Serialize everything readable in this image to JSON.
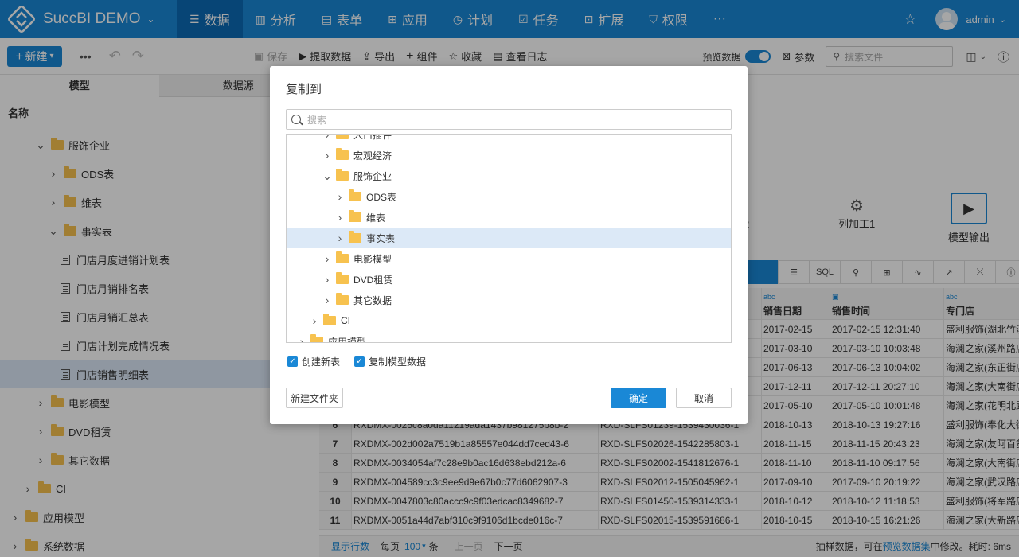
{
  "topnav": {
    "brand": "SuccBI DEMO",
    "tabs": [
      {
        "label": "数据",
        "icon": "database-icon",
        "glyph": "☰"
      },
      {
        "label": "分析",
        "icon": "bar-chart-icon",
        "glyph": "▥"
      },
      {
        "label": "表单",
        "icon": "form-icon",
        "glyph": "▤"
      },
      {
        "label": "应用",
        "icon": "apps-icon",
        "glyph": "⊞"
      },
      {
        "label": "计划",
        "icon": "clock-icon",
        "glyph": "◷"
      },
      {
        "label": "任务",
        "icon": "task-icon",
        "glyph": "☑"
      },
      {
        "label": "扩展",
        "icon": "extension-icon",
        "glyph": "⊡"
      },
      {
        "label": "权限",
        "icon": "shield-icon",
        "glyph": "⛉"
      },
      {
        "label": "···",
        "icon": "more-icon",
        "glyph": ""
      }
    ],
    "user": "admin"
  },
  "toolbar": {
    "new_label": "新建",
    "save": "保存",
    "extract": "提取数据",
    "export": "导出",
    "component": "组件",
    "favorite": "收藏",
    "log": "查看日志",
    "preview": "预览数据",
    "params": "参数",
    "search_placeholder": "搜索文件"
  },
  "left": {
    "tab_model": "模型",
    "tab_source": "数据源",
    "name_header": "名称",
    "tree": [
      {
        "label": "服饰企业",
        "type": "folder",
        "level": 2,
        "open": true
      },
      {
        "label": "ODS表",
        "type": "folder",
        "level": 3,
        "open": false
      },
      {
        "label": "维表",
        "type": "folder",
        "level": 3,
        "open": false
      },
      {
        "label": "事实表",
        "type": "folder",
        "level": 3,
        "open": true
      },
      {
        "label": "门店月度进销计划表",
        "type": "table",
        "level": 4
      },
      {
        "label": "门店月销排名表",
        "type": "table",
        "level": 4
      },
      {
        "label": "门店月销汇总表",
        "type": "table",
        "level": 4
      },
      {
        "label": "门店计划完成情况表",
        "type": "table",
        "level": 4
      },
      {
        "label": "门店销售明细表",
        "type": "table",
        "level": 4,
        "selected": true
      },
      {
        "label": "电影模型",
        "type": "folder",
        "level": 2,
        "open": false
      },
      {
        "label": "DVD租赁",
        "type": "folder",
        "level": 2,
        "open": false
      },
      {
        "label": "其它数据",
        "type": "folder",
        "level": 2,
        "open": false
      },
      {
        "label": "CI",
        "type": "folder",
        "level": 1,
        "open": false
      },
      {
        "label": "应用模型",
        "type": "folder",
        "level": 0,
        "open": false
      },
      {
        "label": "系统数据",
        "type": "folder",
        "level": 0,
        "open": false
      }
    ]
  },
  "flow": {
    "node1": "工2",
    "node2": "列加工1",
    "node3": "模型输出"
  },
  "data_toolbar": [
    "",
    "☰",
    "SQL",
    "⚲",
    "⊞",
    "∿",
    "↗",
    "⤫",
    "ⓘ"
  ],
  "grid": {
    "headers": [
      {
        "type": "",
        "name": ""
      },
      {
        "type": "",
        "name": ""
      },
      {
        "type": "",
        "name": ""
      },
      {
        "type": "abc",
        "name": "销售日期"
      },
      {
        "type": "▣",
        "name": "销售时间"
      },
      {
        "type": "abc",
        "name": "专门店"
      }
    ],
    "rows": [
      [
        "",
        "",
        "",
        "2017-02-15",
        "2017-02-15 12:31:40",
        "盛利服饰(湖北竹溪"
      ],
      [
        "",
        "",
        "",
        "2017-03-10",
        "2017-03-10 10:03:48",
        "海澜之家(溪州路店"
      ],
      [
        "",
        "",
        "",
        "2017-06-13",
        "2017-06-13 10:04:02",
        "海澜之家(东正街店"
      ],
      [
        "",
        "",
        "",
        "2017-12-11",
        "2017-12-11 20:27:10",
        "海澜之家(大南街店"
      ],
      [
        "",
        "",
        "",
        "2017-05-10",
        "2017-05-10 10:01:48",
        "海澜之家(花明北路"
      ],
      [
        "6",
        "RXDMX-0025c8a0da11219ada1437b981275b8b-2",
        "RXD-SLFS01239-1539430036-1",
        "2018-10-13",
        "2018-10-13 19:27:16",
        "盛利服饰(奉化大街"
      ],
      [
        "7",
        "RXDMX-002d002a7519b1a85557e044dd7ced43-6",
        "RXD-SLFS02026-1542285803-1",
        "2018-11-15",
        "2018-11-15 20:43:23",
        "海澜之家(友阿百货"
      ],
      [
        "8",
        "RXDMX-0034054af7c28e9b0ac16d638ebd212a-6",
        "RXD-SLFS02002-1541812676-1",
        "2018-11-10",
        "2018-11-10 09:17:56",
        "海澜之家(大南街店"
      ],
      [
        "9",
        "RXDMX-004589cc3c9ee9d9e67b0c77d6062907-3",
        "RXD-SLFS02012-1505045962-1",
        "2017-09-10",
        "2017-09-10 20:19:22",
        "海澜之家(武汉路店"
      ],
      [
        "10",
        "RXDMX-0047803c80accc9c9f03edcac8349682-7",
        "RXD-SLFS01450-1539314333-1",
        "2018-10-12",
        "2018-10-12 11:18:53",
        "盛利服饰(将军路店"
      ],
      [
        "11",
        "RXDMX-0051a44d7abf310c9f9106d1bcde016c-7",
        "RXD-SLFS02015-1539591686-1",
        "2018-10-15",
        "2018-10-15 16:21:26",
        "海澜之家(大新路店"
      ]
    ]
  },
  "pager": {
    "show_rows": "显示行数",
    "per_page": "每页",
    "per_page_value": "100",
    "unit": "条",
    "prev": "上一页",
    "next": "下一页",
    "note_prefix": "抽样数据，可在",
    "note_link": "预览数据集",
    "note_suffix": "中修改。耗时: 6ms"
  },
  "dialog": {
    "title": "复制到",
    "search_placeholder": "搜索",
    "tree": [
      {
        "label": "人口插件",
        "level": 2,
        "open": false
      },
      {
        "label": "宏观经济",
        "level": 2,
        "open": false
      },
      {
        "label": "服饰企业",
        "level": 2,
        "open": true
      },
      {
        "label": "ODS表",
        "level": 3,
        "open": false
      },
      {
        "label": "维表",
        "level": 3,
        "open": false
      },
      {
        "label": "事实表",
        "level": 3,
        "open": false,
        "selected": true
      },
      {
        "label": "电影模型",
        "level": 2,
        "open": false
      },
      {
        "label": "DVD租赁",
        "level": 2,
        "open": false
      },
      {
        "label": "其它数据",
        "level": 2,
        "open": false
      },
      {
        "label": "CI",
        "level": 1,
        "open": false
      },
      {
        "label": "应用模型",
        "level": 0,
        "open": false
      }
    ],
    "check_create": "创建新表",
    "check_copy": "复制模型数据",
    "new_folder": "新建文件夹",
    "ok": "确定",
    "cancel": "取消"
  },
  "colors": {
    "accent": "#1a88d6",
    "nav_active": "#0b6ab6",
    "folder": "#f7c24f",
    "selection": "#dce9f7"
  }
}
